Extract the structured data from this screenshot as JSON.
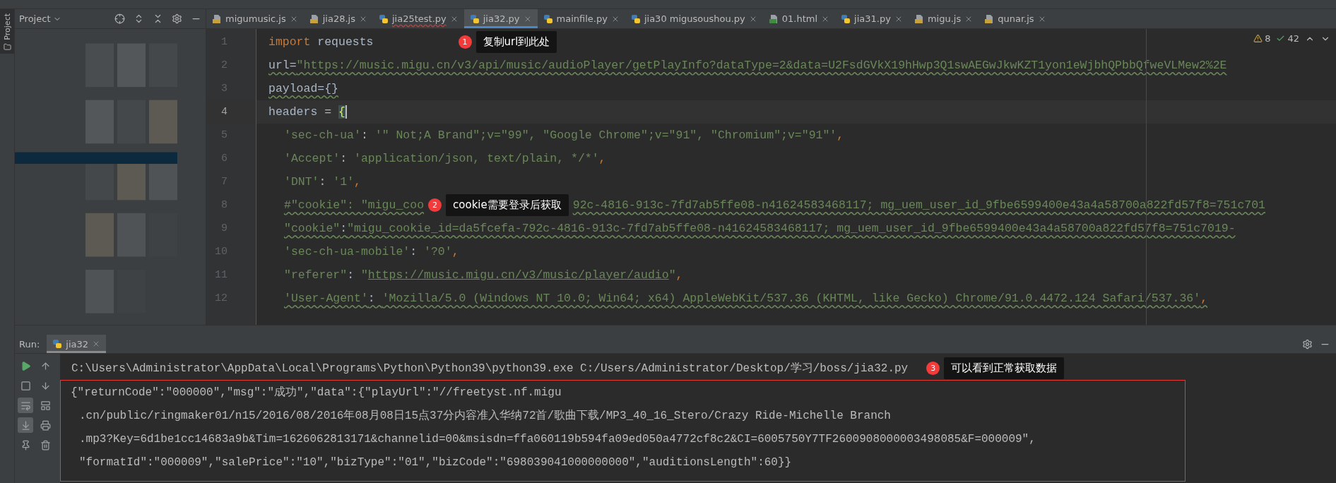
{
  "project_panel": {
    "strip_label": "Project",
    "title": "Project"
  },
  "tabs": [
    {
      "label": "migumusic.js",
      "kind": "js",
      "selected": false,
      "error": false
    },
    {
      "label": "jia28.js",
      "kind": "js",
      "selected": false,
      "error": false
    },
    {
      "label": "jia25test.py",
      "kind": "py",
      "selected": false,
      "error": true
    },
    {
      "label": "jia32.py",
      "kind": "py",
      "selected": true,
      "error": false
    },
    {
      "label": "mainfile.py",
      "kind": "py",
      "selected": false,
      "error": false
    },
    {
      "label": "jia30 migusoushou.py",
      "kind": "py",
      "selected": false,
      "error": false
    },
    {
      "label": "01.html",
      "kind": "html",
      "selected": false,
      "error": false
    },
    {
      "label": "jia31.py",
      "kind": "py",
      "selected": false,
      "error": false
    },
    {
      "label": "migu.js",
      "kind": "js",
      "selected": false,
      "error": false
    },
    {
      "label": "qunar.js",
      "kind": "js",
      "selected": false,
      "error": false
    }
  ],
  "inspections": {
    "warnings": "8",
    "typos": "42"
  },
  "code_lines": [
    {
      "number": "1",
      "current": false,
      "indented": false,
      "warning": false,
      "tokens": [
        {
          "kind": "keyword",
          "text": "import "
        },
        {
          "kind": "plain",
          "text": "requests"
        }
      ],
      "note": {
        "badge": "1",
        "text": "复制url到此处"
      }
    },
    {
      "number": "2",
      "current": false,
      "indented": false,
      "warning": true,
      "tokens": [
        {
          "kind": "plain",
          "text": "url="
        },
        {
          "kind": "string",
          "text": "\"https://music.migu.cn/v3/api/music/audioPlayer/getPlayInfo?dataType=2&data=U2FsdGVkX19hHwp3Q1swAEGwJkwKZT1yon1eWjbhQPbbQfweVLMew2%2E"
        }
      ]
    },
    {
      "number": "3",
      "current": false,
      "indented": false,
      "warning": true,
      "tokens": [
        {
          "kind": "plain",
          "text": "payload={}"
        }
      ]
    },
    {
      "number": "4",
      "current": true,
      "indented": false,
      "warning": false,
      "tokens": [
        {
          "kind": "plain",
          "text": "headers = "
        },
        {
          "kind": "brace",
          "text": "{"
        }
      ]
    },
    {
      "number": "5",
      "current": false,
      "indented": true,
      "warning": false,
      "tokens": [
        {
          "kind": "string",
          "text": "'sec-ch-ua'"
        },
        {
          "kind": "plain",
          "text": ": "
        },
        {
          "kind": "string",
          "text": "'\" Not;A Brand\";v=\"99\", \"Google Chrome\";v=\"91\", \"Chromium\";v=\"91\"'"
        },
        {
          "kind": "punct",
          "text": ","
        }
      ]
    },
    {
      "number": "6",
      "current": false,
      "indented": true,
      "warning": false,
      "tokens": [
        {
          "kind": "string",
          "text": "'Accept'"
        },
        {
          "kind": "plain",
          "text": ": "
        },
        {
          "kind": "string",
          "text": "'application/json, text/plain, */*'"
        },
        {
          "kind": "punct",
          "text": ","
        }
      ]
    },
    {
      "number": "7",
      "current": false,
      "indented": true,
      "warning": false,
      "tokens": [
        {
          "kind": "string",
          "text": "'DNT'"
        },
        {
          "kind": "plain",
          "text": ": "
        },
        {
          "kind": "string",
          "text": "'1'"
        },
        {
          "kind": "punct",
          "text": ","
        }
      ]
    },
    {
      "number": "8",
      "current": false,
      "indented": true,
      "warning": true,
      "tokens": [
        {
          "kind": "string",
          "text": "#\"cookie\": \"migu_coo"
        }
      ],
      "note": {
        "badge": "2",
        "text": "cookie需要登录后获取"
      },
      "tokens_after": [
        {
          "kind": "string",
          "text": "92c-4816-913c-7fd7ab5ffe08-n41624583468117; mg_uem_user_id_9fbe6599400e43a4a58700a822fd57f8=751c701"
        }
      ]
    },
    {
      "number": "9",
      "current": false,
      "indented": true,
      "warning": true,
      "tokens": [
        {
          "kind": "string",
          "text": "\"cookie\""
        },
        {
          "kind": "plain",
          "text": ":"
        },
        {
          "kind": "string",
          "text": "\"migu_cookie_id=da5fcefa-792c-4816-913c-7fd7ab5ffe08-n41624583468117; mg_uem_user_id_9fbe6599400e43a4a58700a822fd57f8=751c7019-"
        }
      ]
    },
    {
      "number": "10",
      "current": false,
      "indented": true,
      "warning": false,
      "tokens": [
        {
          "kind": "string",
          "text": "'sec-ch-ua-mobile'"
        },
        {
          "kind": "plain",
          "text": ": "
        },
        {
          "kind": "string",
          "text": "'?0'"
        },
        {
          "kind": "punct",
          "text": ","
        }
      ]
    },
    {
      "number": "11",
      "current": false,
      "indented": true,
      "warning": false,
      "tokens": [
        {
          "kind": "string",
          "text": "\"referer\""
        },
        {
          "kind": "plain",
          "text": ": "
        },
        {
          "kind": "string",
          "text": "\""
        },
        {
          "kind": "link",
          "text": "https://music.migu.cn/v3/music/player/audio"
        },
        {
          "kind": "string",
          "text": "\""
        },
        {
          "kind": "punct",
          "text": ","
        }
      ]
    },
    {
      "number": "12",
      "current": false,
      "indented": true,
      "warning": true,
      "tokens": [
        {
          "kind": "string",
          "text": "'User-Agent'"
        },
        {
          "kind": "plain",
          "text": ": "
        },
        {
          "kind": "string",
          "text": "'Mozilla/5.0 (Windows NT 10.0; Win64; x64) AppleWebKit/537.36 (KHTML, like Gecko) Chrome/91.0.4472.124 Safari/537.36'"
        },
        {
          "kind": "punct",
          "text": ","
        }
      ]
    }
  ],
  "run_panel": {
    "label": "Run:",
    "tab": {
      "label": "jia32",
      "selected": true
    },
    "tools": [
      {
        "kind": "play",
        "selected": false
      },
      {
        "kind": "up",
        "selected": false
      },
      {
        "kind": "stop",
        "selected": false
      },
      {
        "kind": "down",
        "selected": false
      },
      {
        "kind": "wrap",
        "selected": true
      },
      {
        "kind": "layout",
        "selected": false
      },
      {
        "kind": "scroll-end",
        "selected": true
      },
      {
        "kind": "print",
        "selected": false
      },
      {
        "kind": "pin",
        "selected": false
      },
      {
        "kind": "trash",
        "selected": false
      }
    ],
    "command": "C:\\Users\\Administrator\\AppData\\Local\\Programs\\Python\\Python39\\python39.exe C:/Users/Administrator/Desktop/学习/boss/jia32.py",
    "note": {
      "badge": "3",
      "text": "可以看到正常获取数据"
    },
    "highlighted_output": [
      "{\"returnCode\":\"000000\",\"msg\":\"成功\",\"data\":{\"playUrl\":\"//freetyst.nf.migu",
      ".cn/public/ringmaker01/n15/2016/08/2016年08月08日15点37分内容准入华纳72首/歌曲下载/MP3_40_16_Stero/Crazy Ride-Michelle Branch",
      ".mp3?Key=6d1be1cc14683a9b&Tim=1626062813171&channelid=00&msisdn=ffa060119b594fa09ed050a4772cf8c2&CI=6005750Y7TF2600908000003498085&F=000009\",",
      "\"formatId\":\"000009\",\"salePrice\":\"10\",\"bizType\":\"01\",\"bizCode\":\"698039041000000000\",\"auditionsLength\":60}}"
    ]
  }
}
